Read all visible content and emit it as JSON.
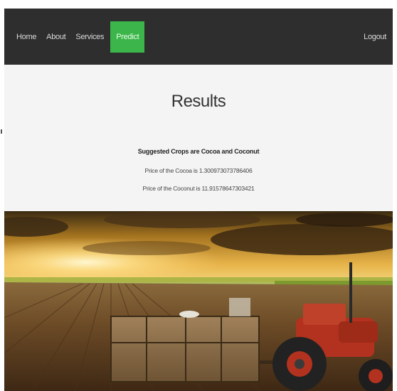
{
  "nav": {
    "items": [
      {
        "label": "Home"
      },
      {
        "label": "About"
      },
      {
        "label": "Services"
      },
      {
        "label": "Predict",
        "active": true
      }
    ],
    "logout": "Logout",
    "active_color": "#3cb54a",
    "bar_color": "#2e2e2e"
  },
  "results": {
    "title": "Results",
    "suggestion": "Suggested Crops are Cocoa and Coconut",
    "price_cocoa": "Price of the Cocoa is 1.300973073786406",
    "price_coconut": "Price of the Coconut is 11.91578647303421"
  },
  "hero": {
    "image": "farm-tractor-field-sunset"
  }
}
